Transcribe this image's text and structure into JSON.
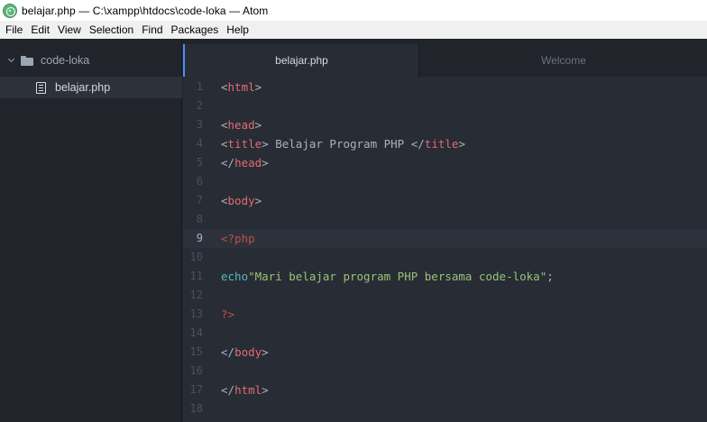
{
  "window": {
    "title": "belajar.php — C:\\xampp\\htdocs\\code-loka — Atom"
  },
  "menu": [
    "File",
    "Edit",
    "View",
    "Selection",
    "Find",
    "Packages",
    "Help"
  ],
  "tree": {
    "root": "code-loka",
    "files": [
      "belajar.php"
    ]
  },
  "tabs": [
    {
      "label": "belajar.php",
      "active": true
    },
    {
      "label": "Welcome",
      "active": false
    }
  ],
  "editor": {
    "cursor_line": 9,
    "lines": [
      {
        "n": "1",
        "tokens": [
          [
            "p",
            "<"
          ],
          [
            "t",
            "html"
          ],
          [
            "p",
            ">"
          ]
        ]
      },
      {
        "n": "2",
        "tokens": []
      },
      {
        "n": "3",
        "tokens": [
          [
            "p",
            "<"
          ],
          [
            "t",
            "head"
          ],
          [
            "p",
            ">"
          ]
        ]
      },
      {
        "n": "4",
        "tokens": [
          [
            "p",
            "<"
          ],
          [
            "t",
            "title"
          ],
          [
            "p",
            "> Belajar Program PHP </"
          ],
          [
            "t",
            "title"
          ],
          [
            "p",
            ">"
          ]
        ]
      },
      {
        "n": "5",
        "tokens": [
          [
            "p",
            "</"
          ],
          [
            "t",
            "head"
          ],
          [
            "p",
            ">"
          ]
        ]
      },
      {
        "n": "6",
        "tokens": []
      },
      {
        "n": "7",
        "tokens": [
          [
            "p",
            "<"
          ],
          [
            "t",
            "body"
          ],
          [
            "p",
            ">"
          ]
        ]
      },
      {
        "n": "8",
        "tokens": []
      },
      {
        "n": "9",
        "tokens": [
          [
            "x",
            "<?php"
          ]
        ]
      },
      {
        "n": "10",
        "tokens": []
      },
      {
        "n": "11",
        "tokens": [
          [
            "f",
            "echo"
          ],
          [
            "s",
            "\"Mari belajar program PHP bersama code-loka\""
          ],
          [
            "p",
            ";"
          ]
        ]
      },
      {
        "n": "12",
        "tokens": []
      },
      {
        "n": "13",
        "tokens": [
          [
            "x",
            "?>"
          ]
        ]
      },
      {
        "n": "14",
        "tokens": []
      },
      {
        "n": "15",
        "tokens": [
          [
            "p",
            "</"
          ],
          [
            "t",
            "body"
          ],
          [
            "p",
            ">"
          ]
        ]
      },
      {
        "n": "16",
        "tokens": []
      },
      {
        "n": "17",
        "tokens": [
          [
            "p",
            "</"
          ],
          [
            "t",
            "html"
          ],
          [
            "p",
            ">"
          ]
        ]
      },
      {
        "n": "18",
        "tokens": []
      }
    ]
  },
  "colors": {
    "tag": "#e06c75",
    "plain": "#abb2bf",
    "function": "#56b6c2",
    "string": "#98c379",
    "php_delimiter": "#be5046",
    "accent": "#528bff"
  }
}
